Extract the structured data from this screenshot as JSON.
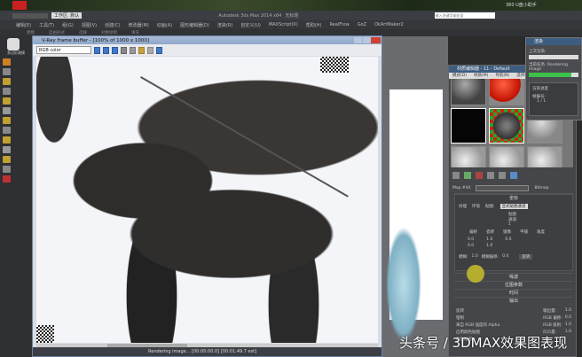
{
  "desktop": {
    "clock": "360 U盘小助手"
  },
  "app": {
    "title": "Autodesk 3ds Max 2014 x64",
    "doc": "无标题",
    "workspace": "工作区: 默认",
    "search_placeholder": "键入关键字或短语"
  },
  "menu": [
    "编辑(E)",
    "工具(T)",
    "组(G)",
    "视图(V)",
    "创建(C)",
    "修改器(M)",
    "动画(A)",
    "图形编辑器(D)",
    "渲染(R)",
    "自定义(U)",
    "MAXScript(X)",
    "帮助(H)",
    "RealFlow",
    "GoZ",
    "OkArtMaker2"
  ],
  "toolbar": [
    "建模",
    "自由形式",
    "选择",
    "对象绘制",
    "填充"
  ],
  "left": {
    "label": "多边形建模"
  },
  "vfb": {
    "title": "V-Ray frame buffer - [100% of 1000 x 1000]",
    "channel": "RGB color",
    "status": "Rendering image... [00:00:00.0] [00:01:49.7 est]"
  },
  "material_editor": {
    "title": "材质编辑器 - 11 - Default",
    "menu": [
      "模式(D)",
      "材质(M)",
      "导航(N)",
      "选项(O)",
      "实用程序(U)"
    ],
    "map_name": "Map #44",
    "map_type": "Bitmap",
    "coords": {
      "title": "坐标",
      "texture": "纹理",
      "env": "环境",
      "mapping": "贴图:",
      "mapping_value": "显式贴图通道",
      "channel_label": "贴图通道:",
      "channel": "1",
      "offset": "偏移",
      "tiling": "瓷砖",
      "mirror": "镜像",
      "tile": "平铺",
      "angle": "角度",
      "u": "0.0",
      "v": "0.0",
      "tu": "1.0",
      "tv": "1.0",
      "w": "0.0",
      "blur_label": "模糊:",
      "blur": "1.0",
      "blur_offset_label": "模糊偏移:",
      "blur_offset": "0.0",
      "rotate": "旋转"
    },
    "rollouts": [
      "噪波",
      "位图参数",
      "时间",
      "输出"
    ],
    "output": {
      "invert": "反转",
      "clamp": "钳制",
      "alpha_from_rgb": "来自 RGB 强度的 Alpha",
      "enable_color_map": "启用颜色贴图",
      "output_amount": "输出量:",
      "rgb_offset": "RGB 偏移:",
      "rgb_level": "RGB 级别:",
      "bump_amount": "凹凸量:",
      "v1": "1.0",
      "v2": "0.0",
      "v3": "1.0",
      "v4": "1.0",
      "color_map": "颜色贴图:"
    }
  },
  "render_dialog": {
    "title": "渲染",
    "last_render": "上次渲染:",
    "current_task": "当前任务:",
    "task": "Rendering image",
    "progress": 0.85,
    "section": "渲染进度",
    "pass": "帧编号:",
    "frames": "1 / 1"
  },
  "watermark": "头条号 / 3DMAX效果图表现",
  "colors": {
    "accent": "#3f78c8",
    "progress": "#3cc24a",
    "cursor_highlight": "#c8c02a"
  }
}
